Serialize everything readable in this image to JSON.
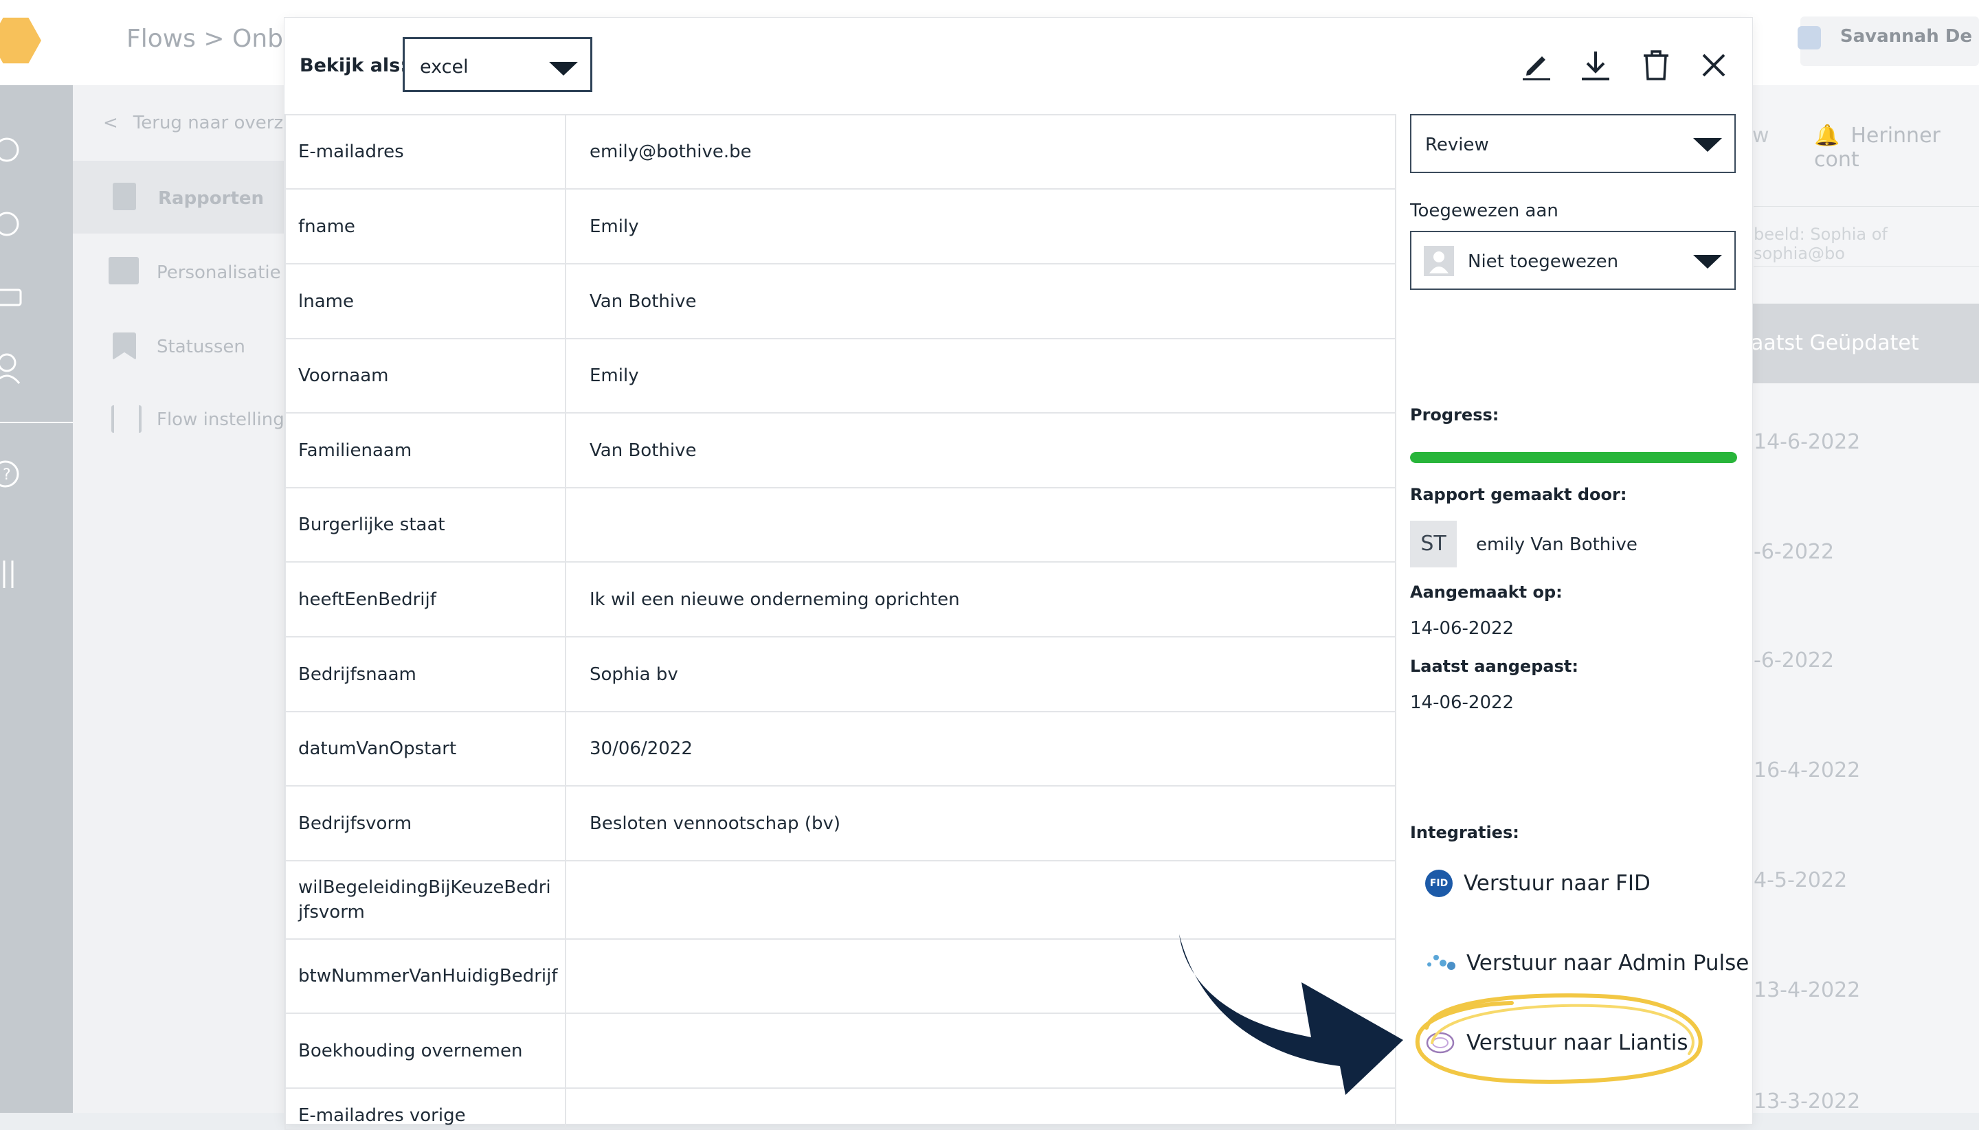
{
  "background": {
    "breadcrumb": "Flows  >  Onb",
    "user_name": "Savannah De",
    "back_link": "Terug naar overzi",
    "nav": [
      "Rapporten",
      "Personalisatie",
      "Statussen",
      "Flow instellinge"
    ],
    "reminder": "Herinner cont",
    "tab_partial": "w",
    "search_placeholder": "beeld: Sophia of sophia@bo",
    "column_header": "aatst Geüpdatet",
    "dates": [
      "14-6-2022",
      "-6-2022",
      "-6-2022",
      "16-4-2022",
      "4-5-2022",
      "13-4-2022",
      "13-3-2022"
    ]
  },
  "modal": {
    "view_as_label": "Bekijk als:",
    "view_as_value": "excel",
    "icons": [
      "edit-icon",
      "download-icon",
      "trash-icon",
      "close-icon"
    ],
    "fields": [
      {
        "key": "E-mailadres",
        "value": "emily@bothive.be"
      },
      {
        "key": "fname",
        "value": "Emily"
      },
      {
        "key": "lname",
        "value": "Van Bothive"
      },
      {
        "key": "Voornaam",
        "value": "Emily"
      },
      {
        "key": "Familienaam",
        "value": "Van Bothive"
      },
      {
        "key": "Burgerlijke staat",
        "value": ""
      },
      {
        "key": "heeftEenBedrijf",
        "value": "Ik wil een nieuwe onderneming oprichten"
      },
      {
        "key": "Bedrijfsnaam",
        "value": "Sophia bv"
      },
      {
        "key": "datumVanOpstart",
        "value": "30/06/2022"
      },
      {
        "key": "Bedrijfsvorm",
        "value": "Besloten vennootschap (bv)"
      },
      {
        "key": "wilBegeleidingBijKeuzeBedrijfsvorm",
        "value": ""
      },
      {
        "key": "btwNummerVanHuidigBedrijf",
        "value": ""
      },
      {
        "key": "Boekhouding overnemen",
        "value": ""
      },
      {
        "key": "E-mailadres vorige",
        "value": ""
      }
    ],
    "status_value": "Review",
    "assigned_label": "Toegewezen aan",
    "assigned_value": "Niet toegewezen",
    "progress_label": "Progress:",
    "progress_percent": 100,
    "progress_color": "#28b53a",
    "created_by_label": "Rapport gemaakt door:",
    "created_by_initials": "ST",
    "created_by_name": "emily Van Bothive",
    "created_on_label": "Aangemaakt op:",
    "created_on": "14-06-2022",
    "updated_label": "Laatst aangepast:",
    "updated_on": "14-06-2022",
    "integrations_label": "Integraties:",
    "integrations": [
      {
        "label": "Verstuur naar FID",
        "icon": "fid-logo-icon"
      },
      {
        "label": "Verstuur naar Admin Pulse",
        "icon": "admin-pulse-logo-icon"
      },
      {
        "label": "Verstuur naar Liantis",
        "icon": "liantis-logo-icon"
      }
    ],
    "highlight_color": "#f2c744",
    "arrow_color": "#0f2440"
  }
}
